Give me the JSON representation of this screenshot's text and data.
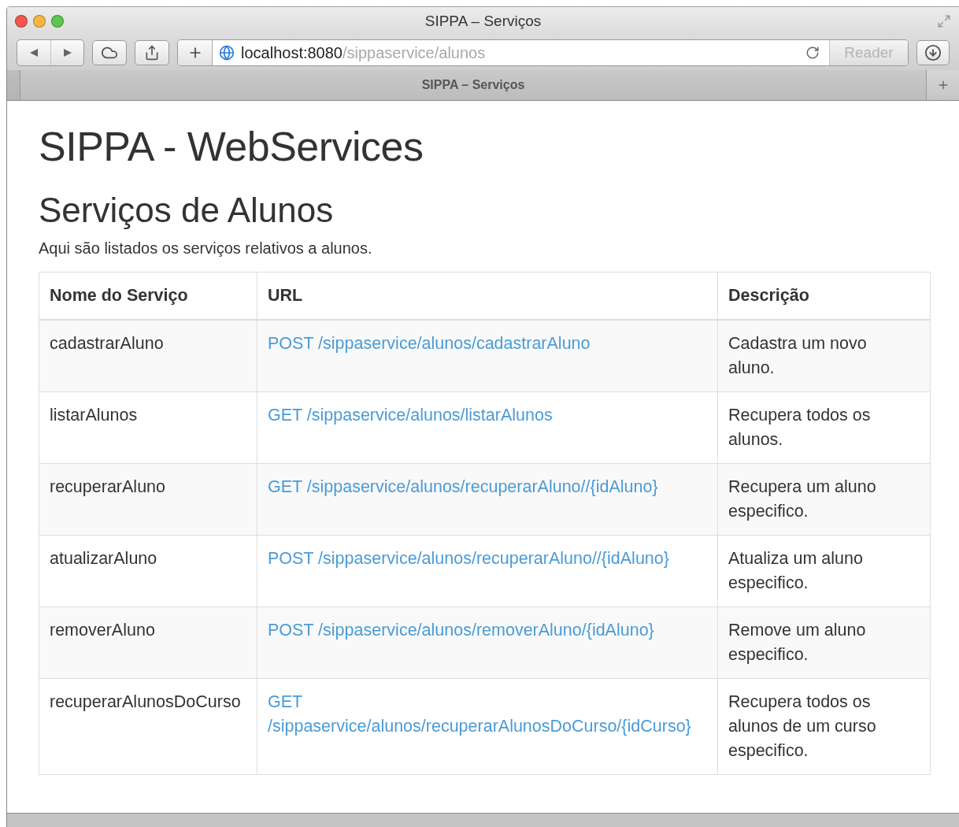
{
  "window": {
    "title": "SIPPA – Serviços"
  },
  "toolbar": {
    "address_host": "localhost:8080",
    "address_path": "/sippaservice/alunos",
    "reader": {
      "label": "Reader",
      "disabled": true
    }
  },
  "tab": {
    "label": "SIPPA – Serviços"
  },
  "page": {
    "heading": "SIPPA - WebServices",
    "subheading": "Serviços de Alunos",
    "intro": "Aqui são listados os serviços relativos a alunos.",
    "table": {
      "columns": [
        "Nome do Serviço",
        "URL",
        "Descrição"
      ],
      "rows": [
        {
          "name": "cadastrarAluno",
          "url": "POST /sippaservice/alunos/cadastrarAluno",
          "description": "Cadastra um novo aluno."
        },
        {
          "name": "listarAlunos",
          "url": "GET /sippaservice/alunos/listarAlunos",
          "description": "Recupera todos os alunos."
        },
        {
          "name": "recuperarAluno",
          "url": "GET /sippaservice/alunos/recuperarAluno//{idAluno}",
          "description": "Recupera um aluno especifico."
        },
        {
          "name": "atualizarAluno",
          "url": "POST /sippaservice/alunos/recuperarAluno//{idAluno}",
          "description": "Atualiza um aluno especifico."
        },
        {
          "name": "removerAluno",
          "url": "POST /sippaservice/alunos/removerAluno/{idAluno}",
          "description": "Remove um aluno especifico."
        },
        {
          "name": "recuperarAlunosDoCurso",
          "url": "GET /sippaservice/alunos/recuperarAlunosDoCurso/{idCurso}",
          "description": "Recupera todos os alunos de um curso especifico."
        }
      ]
    }
  }
}
